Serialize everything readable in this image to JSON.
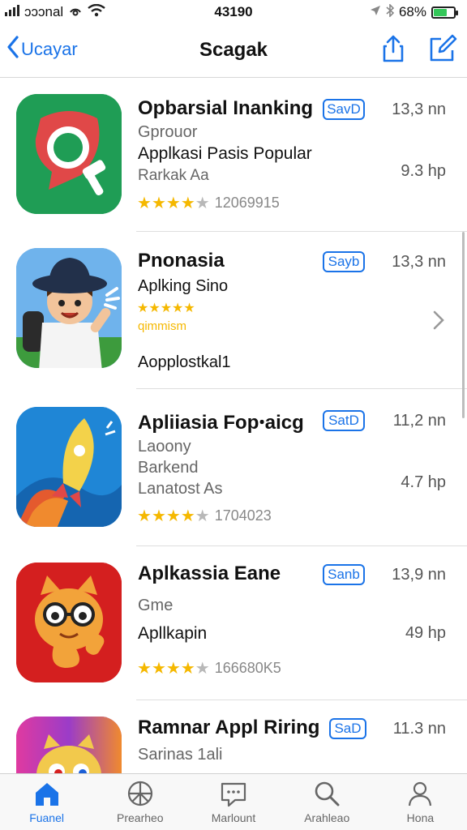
{
  "status_bar": {
    "carrier": "ɔɔɔnal",
    "time": "43190",
    "battery": "68%",
    "battery_level": 0.68
  },
  "nav": {
    "back_label": "Ucayar",
    "title": "Scagak"
  },
  "apps": [
    {
      "name": "Opbarsial Inanking",
      "badge": "SavD",
      "size": "13,3 nn",
      "category": "Gprouor",
      "subtitle": "Applkasi Pasis Popular",
      "detail": "Rarkak Aa",
      "size2": "9.3 hp",
      "rating": 4,
      "rating_count": "12069915"
    },
    {
      "name": "Pnonasia",
      "badge": "Sayb",
      "size": "13,3 nn",
      "subtitle": "Aplking Sino",
      "rating": 5,
      "rating_text": "qimmism",
      "detail": "Aopplostkal1"
    },
    {
      "name": "Apliiasia Fopꞏaicg",
      "badge": "SatD",
      "size": "11,2 nn",
      "category": "Laoony",
      "subtitle": "Barkend",
      "detail": "Lanatost As",
      "size2": "4.7 hp",
      "rating": 4,
      "rating_count": "1704023"
    },
    {
      "name": "Aplkassia Eane",
      "badge": "Sanb",
      "size": "13,9 nn",
      "category": "Gme",
      "subtitle": "Apllkapin",
      "size2": "49 hp",
      "rating": 4,
      "rating_count": "166680K5"
    },
    {
      "name": "Ramnar Appl Riring",
      "badge": "SaD",
      "size": "11.3 nn",
      "category": "Sarinas 1ali"
    }
  ],
  "tabs": [
    {
      "label": "Fuanel",
      "icon": "home-icon",
      "active": true
    },
    {
      "label": "Prearheo",
      "icon": "globe-icon"
    },
    {
      "label": "Marlount",
      "icon": "message-icon"
    },
    {
      "label": "Arahleao",
      "icon": "search-icon"
    },
    {
      "label": "Hona",
      "icon": "person-icon"
    }
  ],
  "colors": {
    "accent": "#1a73e8",
    "star": "#f5b800",
    "battery": "#34c759"
  }
}
